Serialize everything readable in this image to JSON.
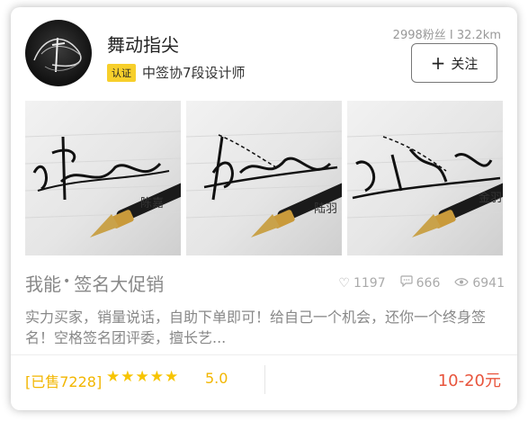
{
  "profile": {
    "name": "舞动指尖",
    "badge": "认证",
    "title": "中签协7段设计师",
    "stats": "2998粉丝 I 32.2km",
    "follow_label": "关注"
  },
  "photos": [
    {
      "caption": "陈嘉"
    },
    {
      "caption": "陆羽"
    },
    {
      "caption": "金羽"
    }
  ],
  "listing": {
    "headline_pre": "我能",
    "headline_dot": "•",
    "headline_post": "签名大促销",
    "likes": "1197",
    "comments": "666",
    "views": "6941",
    "description": "实力买家，销量说话，自助下单即可！给自己一个机会，还你一个终身签名！空格签名团评委，擅长艺...",
    "sold": "[已售7228]",
    "stars": "★★★★★",
    "rating": "5.0",
    "price": "10-20元"
  },
  "colors": {
    "accent": "#f7cf2b",
    "price": "#e8553d",
    "sold": "#f2b600"
  }
}
